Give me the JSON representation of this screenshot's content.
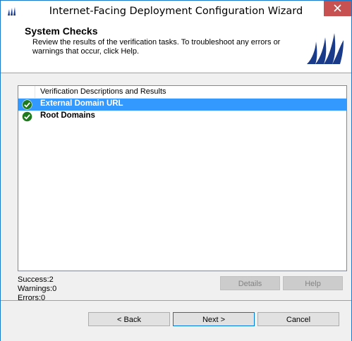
{
  "window": {
    "title": "Internet-Facing Deployment Configuration Wizard"
  },
  "header": {
    "title": "System Checks",
    "description": "Review the results of the verification tasks. To troubleshoot any errors or warnings that occur, click Help."
  },
  "results_list": {
    "column_header": "Verification Descriptions and Results",
    "rows": [
      {
        "label": "External Domain URL",
        "status": "success",
        "selected": true
      },
      {
        "label": "Root Domains",
        "status": "success",
        "selected": false
      }
    ]
  },
  "summary": {
    "success": "Success:2",
    "warnings": "Warnings:0",
    "errors": "Errors:0"
  },
  "buttons": {
    "details": "Details",
    "help": "Help",
    "back": "< Back",
    "next": "Next >",
    "cancel": "Cancel"
  },
  "colors": {
    "selection": "#3399ff",
    "success_icon": "#1f7a1f",
    "close_button": "#c75050",
    "logo": "#1a3a8a"
  }
}
